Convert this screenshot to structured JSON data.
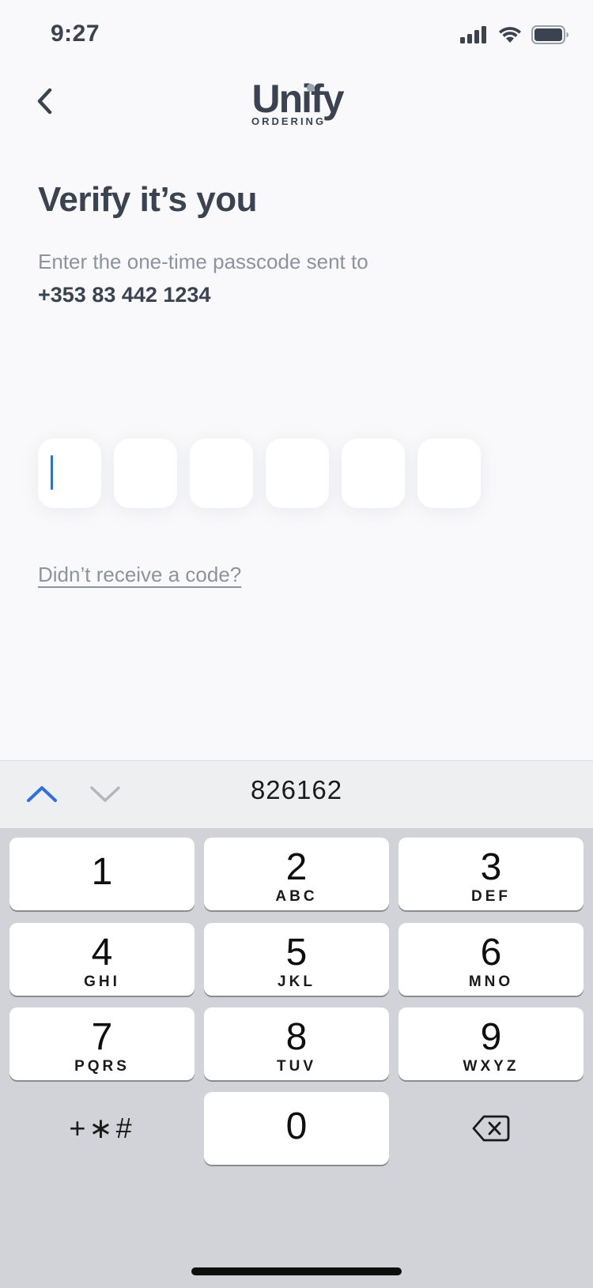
{
  "status_bar": {
    "time": "9:27"
  },
  "logo": {
    "word": "Unify",
    "sub": "ORDERING"
  },
  "title": "Verify it’s you",
  "subtitle": "Enter the one-time passcode sent to",
  "phone": "+353 83 442 1234",
  "otp": {
    "digits": [
      "",
      "",
      "",
      "",
      "",
      ""
    ],
    "active_index": 0
  },
  "resend_label": "Didn’t receive a code?",
  "keyboard": {
    "suggestion": "826162",
    "keys": [
      {
        "num": "1",
        "letters": ""
      },
      {
        "num": "2",
        "letters": "ABC"
      },
      {
        "num": "3",
        "letters": "DEF"
      },
      {
        "num": "4",
        "letters": "GHI"
      },
      {
        "num": "5",
        "letters": "JKL"
      },
      {
        "num": "6",
        "letters": "MNO"
      },
      {
        "num": "7",
        "letters": "PQRS"
      },
      {
        "num": "8",
        "letters": "TUV"
      },
      {
        "num": "9",
        "letters": "WXYZ"
      },
      {
        "num": "0",
        "letters": ""
      }
    ],
    "symbols_label": "+∗#"
  },
  "colors": {
    "accent": "#2f6fe0",
    "text": "#3b4250",
    "muted": "#8d939c",
    "background": "#f9f9fb"
  },
  "icons": {
    "back": "chevron-left-icon",
    "signal": "signal-icon",
    "wifi": "wifi-icon",
    "battery": "battery-icon",
    "prev_field": "chevron-up-icon",
    "next_field": "chevron-down-icon",
    "delete": "backspace-icon"
  }
}
